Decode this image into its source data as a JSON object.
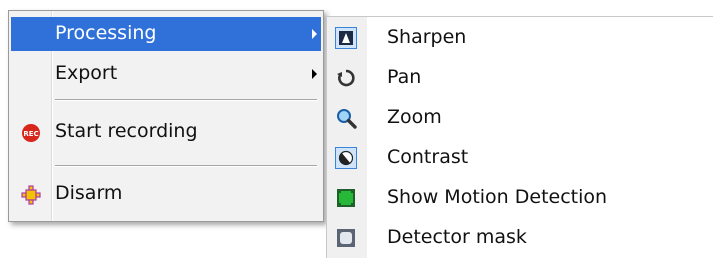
{
  "context_menu": {
    "items": [
      {
        "label": "Processing",
        "has_submenu": true,
        "highlighted": true
      },
      {
        "label": "Export",
        "has_submenu": true
      },
      {
        "label": "Start recording",
        "icon": "rec-icon",
        "icon_text": "REC"
      },
      {
        "label": "Disarm",
        "icon": "disarm-icon"
      }
    ]
  },
  "submenu": {
    "items": [
      {
        "label": "Sharpen",
        "icon": "sharpen-icon",
        "checked": true
      },
      {
        "label": "Pan",
        "icon": "pan-icon"
      },
      {
        "label": "Zoom",
        "icon": "zoom-icon"
      },
      {
        "label": "Contrast",
        "icon": "contrast-icon",
        "checked": true
      },
      {
        "label": "Show Motion Detection",
        "icon": "motion-detection-icon"
      },
      {
        "label": "Detector mask",
        "icon": "detector-mask-icon"
      }
    ]
  },
  "colors": {
    "highlight": "#2f71d8",
    "rec": "#d9261c",
    "disarm": "#f2c400",
    "motion": "#27b83a"
  }
}
